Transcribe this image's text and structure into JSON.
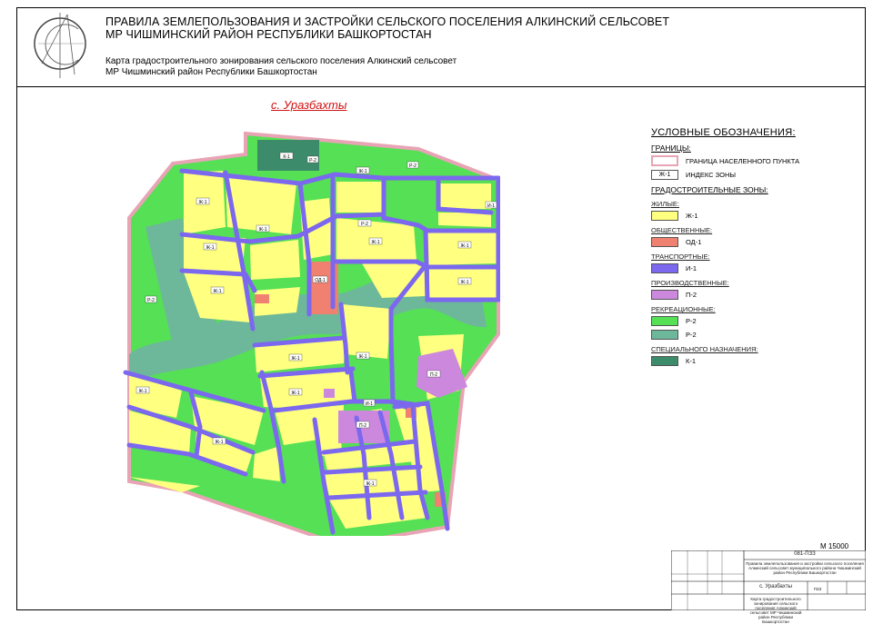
{
  "header": {
    "title_line1": "ПРАВИЛА ЗЕМЛЕПОЛЬЗОВАНИЯ И ЗАСТРОЙКИ СЕЛЬСКОГО ПОСЕЛЕНИЯ АЛКИНСКИЙ СЕЛЬСОВЕТ",
    "title_line2": "МР ЧИШМИНСКИЙ РАЙОН РЕСПУБЛИКИ БАШКОРТОСТАН",
    "subtitle_line1": "Карта градостроительного зонирования сельского поселения Алкинский сельсовет",
    "subtitle_line2": "МР Чишминский район Республики Башкортостан"
  },
  "village_label": "с. Уразбахты",
  "scale": "М 15000",
  "colors": {
    "residential": "#ffff80",
    "public": "#f08070",
    "transport": "#7b68ee",
    "industrial": "#cc88dd",
    "recreation_green": "#55e055",
    "recreation_teal": "#6db89a",
    "special": "#3c8c6c",
    "boundary": "#e8a4b4"
  },
  "legend": {
    "title": "УСЛОВНЫЕ ОБОЗНАЧЕНИЯ:",
    "boundaries_header": "ГРАНИЦЫ:",
    "boundary_label": "ГРАНИЦА НАСЕЛЕННОГО ПУНКТА",
    "index_swatch": "Ж-1",
    "index_label": "ИНДЕКС ЗОНЫ",
    "zones_header": "ГРАДОСТРОИТЕЛЬНЫЕ ЗОНЫ:",
    "groups": [
      {
        "title": "ЖИЛЫЕ:",
        "code": "Ж-1",
        "color": "#ffff80"
      },
      {
        "title": "ОБЩЕСТВЕННЫЕ:",
        "code": "ОД-1",
        "color": "#f08070"
      },
      {
        "title": "ТРАНСПОРТНЫЕ:",
        "code": "И-1",
        "color": "#7b68ee"
      },
      {
        "title": "ПРОИЗВОДСТВЕННЫЕ:",
        "code": "П-2",
        "color": "#cc88dd"
      },
      {
        "title": "РЕКРЕАЦИОННЫЕ:",
        "code": "Р-2",
        "color": "#55e055"
      },
      {
        "title": "",
        "code": "Р-2",
        "color": "#6db89a"
      },
      {
        "title": "СПЕЦИАЛЬНОГО НАЗНАЧЕНИЯ:",
        "code": "К-1",
        "color": "#3c8c6c"
      }
    ]
  },
  "zone_labels": {
    "k1": "К-1",
    "r2": "Р-2",
    "zh1": "Ж-1",
    "i1": "И-1",
    "od1": "ОД-1",
    "p2": "П-2"
  },
  "stamp": {
    "code": "081-ПЗЗ",
    "desc": "Правила землепользования и застройки сельского поселения Алкинский сельсовет муниципального района Чишминский район Республики Башкортостан",
    "sheet_name": "с. Уразбахты",
    "stage": "ПЗЗ",
    "bottom_desc": "Карта градостроительного зонирования сельского поселения Алкинский сельсовет МР Чишминский район Республики Башкортостан"
  }
}
